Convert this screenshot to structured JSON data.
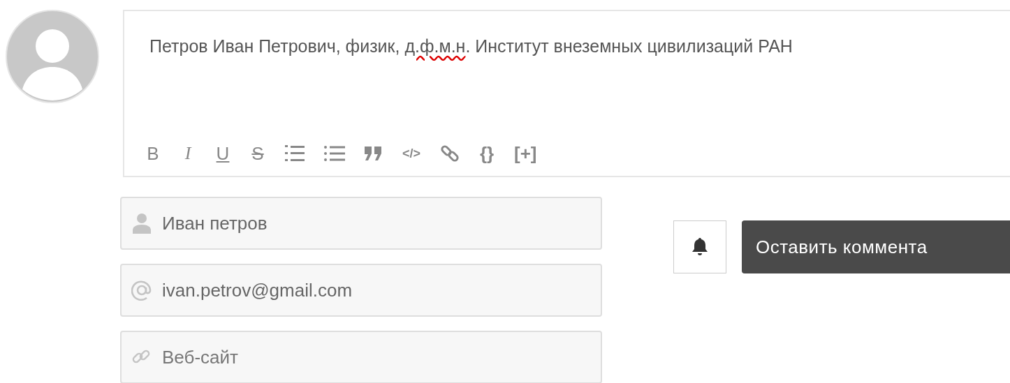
{
  "comment": {
    "before": "Петров Иван Петрович, физик, ",
    "misspelled": "д.ф.м.н",
    "after": ". Институт внеземных цивилизаций РАН"
  },
  "toolbar": [
    {
      "kind": "bold",
      "label": "B"
    },
    {
      "kind": "italic",
      "label": "I"
    },
    {
      "kind": "underline",
      "label": "U"
    },
    {
      "kind": "strike",
      "label": "S"
    },
    {
      "kind": "ordered-list"
    },
    {
      "kind": "bullet-list"
    },
    {
      "kind": "quote"
    },
    {
      "kind": "code",
      "label": "</>"
    },
    {
      "kind": "link"
    },
    {
      "kind": "text",
      "label": "{}"
    },
    {
      "kind": "text",
      "label": "[+]"
    }
  ],
  "fields": [
    {
      "kind": "name",
      "value": "Иван петров"
    },
    {
      "kind": "email",
      "value": "ivan.petrov@gmail.com"
    },
    {
      "kind": "website",
      "placeholder": "Веб-сайт"
    }
  ],
  "submit": {
    "label": "Оставить коммента"
  }
}
